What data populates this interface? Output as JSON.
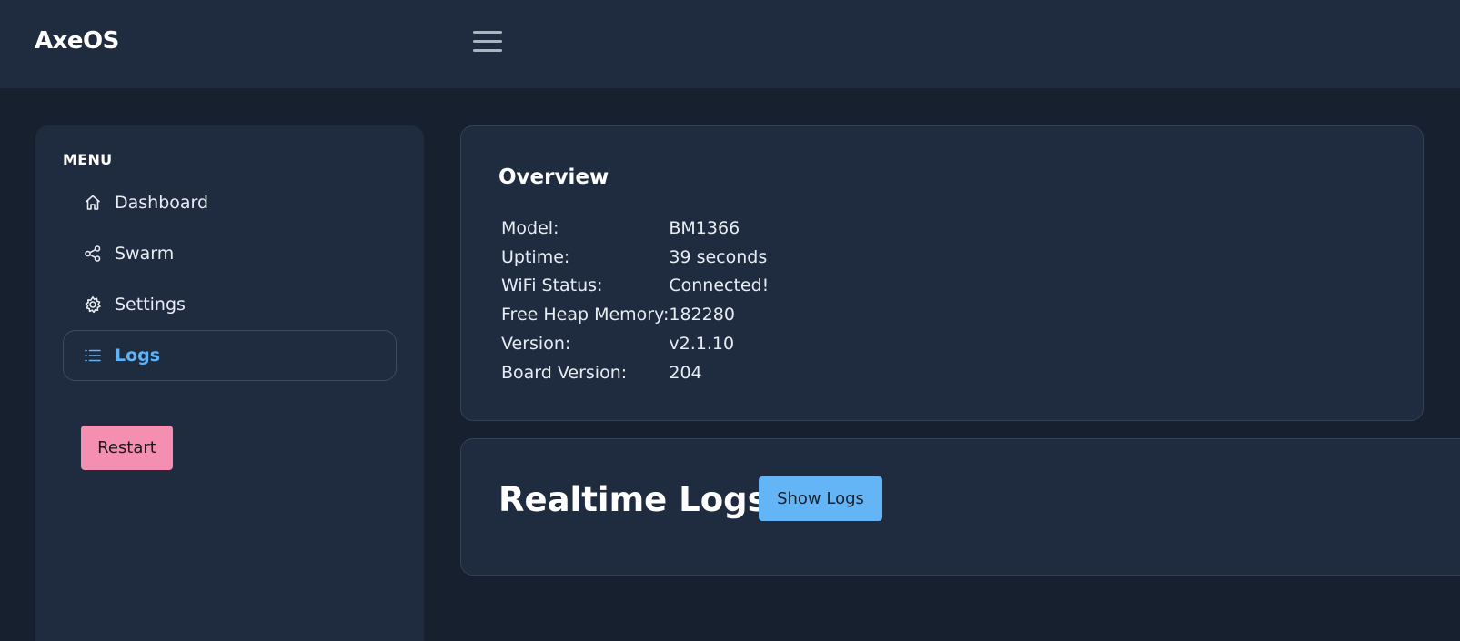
{
  "header": {
    "brand": "AxeOS",
    "menu_toggle_icon": "hamburger-icon"
  },
  "sidebar": {
    "title": "MENU",
    "items": [
      {
        "label": "Dashboard",
        "icon": "home-icon",
        "active": false
      },
      {
        "label": "Swarm",
        "icon": "share-icon",
        "active": false
      },
      {
        "label": "Settings",
        "icon": "gear-icon",
        "active": false
      },
      {
        "label": "Logs",
        "icon": "list-icon",
        "active": true
      }
    ],
    "restart_label": "Restart"
  },
  "overview": {
    "title": "Overview",
    "rows": [
      {
        "key": "Model:",
        "value": "BM1366"
      },
      {
        "key": "Uptime:",
        "value": "39 seconds"
      },
      {
        "key": "WiFi Status:",
        "value": "Connected!"
      },
      {
        "key": "Free Heap Memory:",
        "value": "182280"
      },
      {
        "key": "Version:",
        "value": "v2.1.10"
      },
      {
        "key": "Board Version:",
        "value": "204"
      }
    ]
  },
  "logs": {
    "title": "Realtime Logs",
    "show_logs_label": "Show Logs"
  },
  "colors": {
    "background": "#17202e",
    "panel": "#1f2b3e",
    "accent": "#60b3f5",
    "restart": "#f48fb1",
    "show_logs": "#64b5f6"
  }
}
